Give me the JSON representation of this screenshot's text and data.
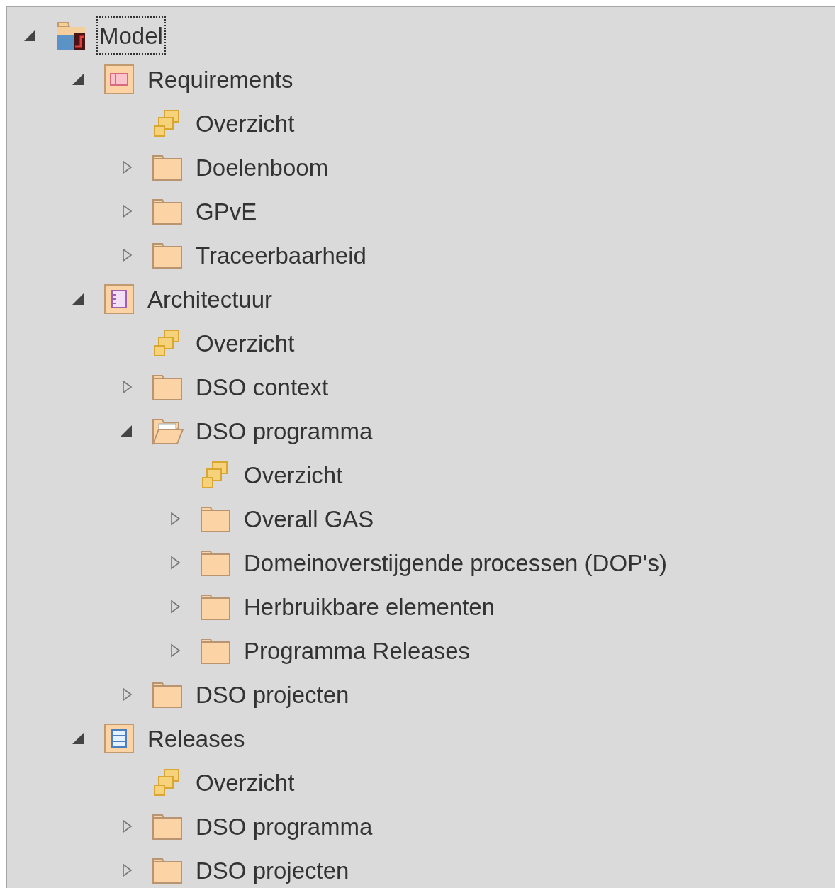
{
  "tree": {
    "label": "Model",
    "kind": "model",
    "expanded": true,
    "focused": true,
    "children": [
      {
        "label": "Requirements",
        "kind": "requirements",
        "expanded": true,
        "children": [
          {
            "label": "Overzicht",
            "kind": "diagram"
          },
          {
            "label": "Doelenboom",
            "kind": "folder",
            "expanded": false
          },
          {
            "label": "GPvE",
            "kind": "folder",
            "expanded": false
          },
          {
            "label": "Traceerbaarheid",
            "kind": "folder",
            "expanded": false
          }
        ]
      },
      {
        "label": "Architectuur",
        "kind": "architecture",
        "expanded": true,
        "children": [
          {
            "label": "Overzicht",
            "kind": "diagram"
          },
          {
            "label": "DSO context",
            "kind": "folder",
            "expanded": false
          },
          {
            "label": "DSO programma",
            "kind": "folder",
            "expanded": true,
            "children": [
              {
                "label": "Overzicht",
                "kind": "diagram"
              },
              {
                "label": "Overall GAS",
                "kind": "folder",
                "expanded": false
              },
              {
                "label": "Domeinoverstijgende processen (DOP's)",
                "kind": "folder",
                "expanded": false
              },
              {
                "label": "Herbruikbare elementen",
                "kind": "folder",
                "expanded": false
              },
              {
                "label": "Programma Releases",
                "kind": "folder",
                "expanded": false
              }
            ]
          },
          {
            "label": "DSO projecten",
            "kind": "folder",
            "expanded": false
          }
        ]
      },
      {
        "label": "Releases",
        "kind": "releases",
        "expanded": true,
        "children": [
          {
            "label": "Overzicht",
            "kind": "diagram"
          },
          {
            "label": "DSO programma",
            "kind": "folder",
            "expanded": false
          },
          {
            "label": "DSO projecten",
            "kind": "folder",
            "expanded": false
          }
        ]
      }
    ]
  }
}
